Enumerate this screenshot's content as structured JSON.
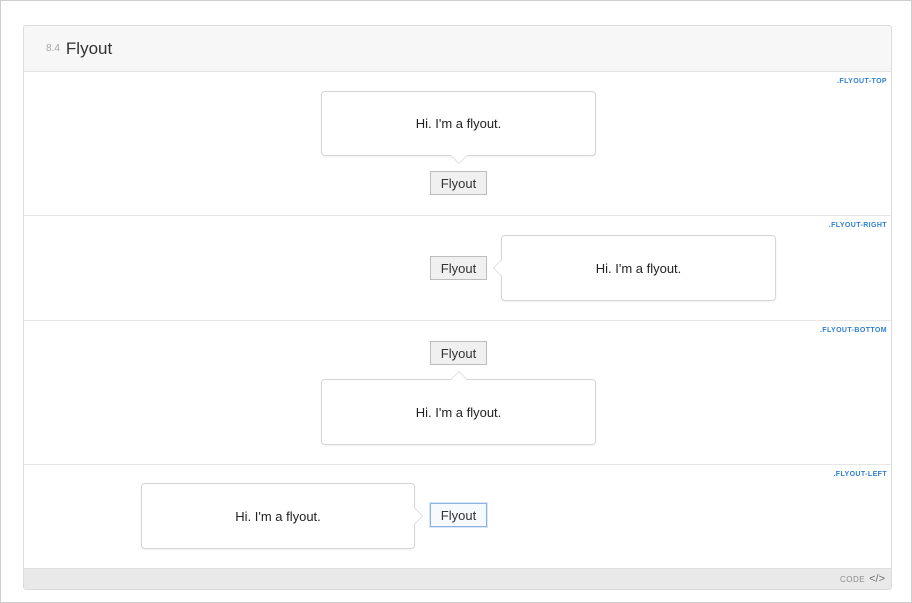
{
  "section": {
    "number": "8.4",
    "title": "Flyout"
  },
  "examples": [
    {
      "tag": ".FLYOUT-TOP",
      "button_label": "Flyout",
      "flyout_text": "Hi. I'm a flyout."
    },
    {
      "tag": ".FLYOUT-RIGHT",
      "button_label": "Flyout",
      "flyout_text": "Hi. I'm a flyout."
    },
    {
      "tag": ".FLYOUT-BOTTOM",
      "button_label": "Flyout",
      "flyout_text": "Hi. I'm a flyout."
    },
    {
      "tag": ".FLYOUT-LEFT",
      "button_label": "Flyout",
      "flyout_text": "Hi. I'm a flyout."
    }
  ],
  "footer": {
    "code_label": "CODE",
    "code_icon": "</>"
  },
  "colors": {
    "tag_accent": "#2f7fd1",
    "focus_border": "#8fb4e0"
  },
  "icons": {
    "code": "code-icon"
  }
}
